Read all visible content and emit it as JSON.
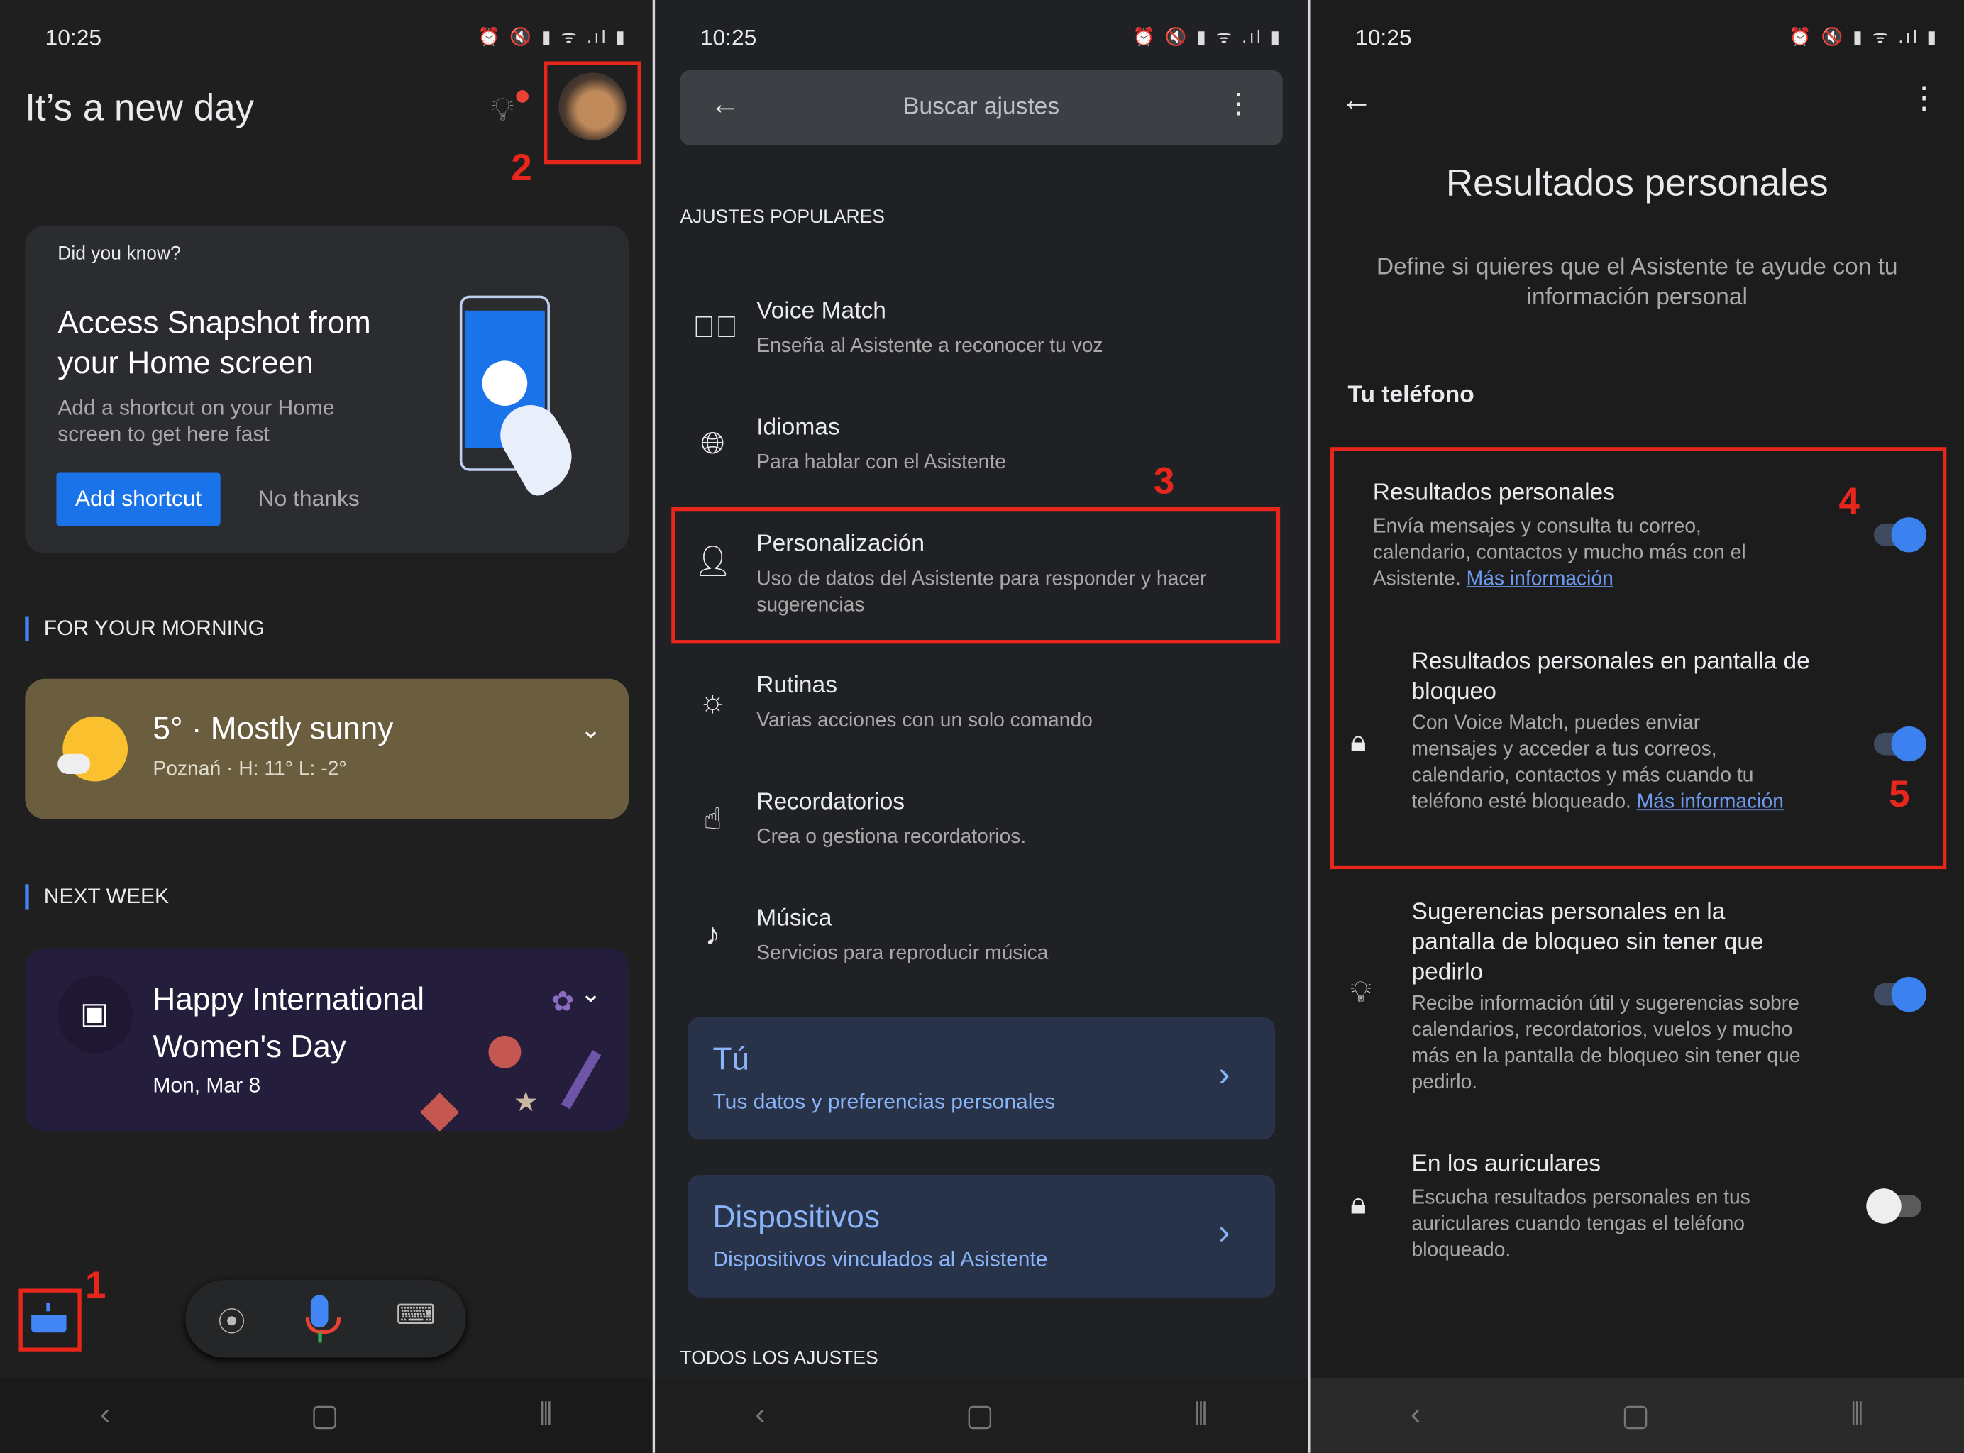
{
  "status_bar": {
    "time": "10:25",
    "icons": [
      "alarm-icon",
      "mute-icon",
      "battery-saver-icon",
      "wifi-icon",
      "signal-icon",
      "battery-icon"
    ]
  },
  "panel1": {
    "greeting": "It’s a new day",
    "tip": {
      "eyebrow": "Did you know?",
      "title": "Access Snapshot from your Home screen",
      "body": "Add a shortcut on your Home screen to get here fast",
      "primary": "Add shortcut",
      "secondary": "No thanks"
    },
    "morning": {
      "section": "FOR YOUR MORNING",
      "weather": "5° · Mostly sunny",
      "detail": "Poznań · H: 11° L: -2°"
    },
    "next_week": {
      "section": "NEXT WEEK",
      "title": "Happy International Women's Day",
      "date": "Mon, Mar 8"
    },
    "markers": {
      "one": "1",
      "two": "2"
    }
  },
  "panel2": {
    "search_placeholder": "Buscar ajustes",
    "popular_header": "AJUSTES POPULARES",
    "items": [
      {
        "icon": "voice-match-icon",
        "title": "Voice Match",
        "desc": "Enseña al Asistente a reconocer tu voz"
      },
      {
        "icon": "globe-icon",
        "title": "Idiomas",
        "desc": "Para hablar con el Asistente"
      },
      {
        "icon": "personalization-icon",
        "title": "Personalización",
        "desc": "Uso de datos del Asistente para responder y hacer sugerencias"
      },
      {
        "icon": "routines-icon",
        "title": "Rutinas",
        "desc": "Varias acciones con un solo comando"
      },
      {
        "icon": "reminder-icon",
        "title": "Recordatorios",
        "desc": "Crea o gestiona recordatorios."
      },
      {
        "icon": "music-icon",
        "title": "Música",
        "desc": "Servicios para reproducir música"
      }
    ],
    "cards": [
      {
        "title": "Tú",
        "desc": "Tus datos y preferencias personales"
      },
      {
        "title": "Dispositivos",
        "desc": "Dispositivos vinculados al Asistente"
      }
    ],
    "all_header": "TODOS LOS AJUSTES",
    "marker": "3"
  },
  "panel3": {
    "title": "Resultados personales",
    "subtitle": "Define si quieres que el Asistente te ayude con tu información personal",
    "section": "Tu teléfono",
    "options": [
      {
        "title": "Resultados personales",
        "desc": "Envía mensajes y consulta tu correo, calendario, contactos y mucho más con el Asistente.",
        "link": "Más información",
        "enabled": true
      },
      {
        "icon": "lock-icon",
        "title": "Resultados personales en pantalla de bloqueo",
        "desc": "Con Voice Match, puedes enviar mensajes y acceder a tus correos, calendario, contactos y más cuando tu teléfono esté bloqueado.",
        "link": "Más información",
        "enabled": true
      },
      {
        "icon": "lightbulb-icon",
        "title": "Sugerencias personales en la pantalla de bloqueo sin tener que pedirlo",
        "desc": "Recibe información útil y sugerencias sobre calendarios, recordatorios, vuelos y mucho más en la pantalla de bloqueo sin tener que pedirlo.",
        "enabled": true
      },
      {
        "icon": "lock-icon",
        "title": "En los auriculares",
        "desc": "Escucha resultados personales en tus auriculares cuando tengas el teléfono bloqueado.",
        "enabled": false
      }
    ],
    "markers": {
      "four": "4",
      "five": "5"
    }
  },
  "colors": {
    "accent": "#4285f4",
    "annotation": "#e8261b",
    "link": "#6f9cf2",
    "card_blue": "#28334a"
  }
}
